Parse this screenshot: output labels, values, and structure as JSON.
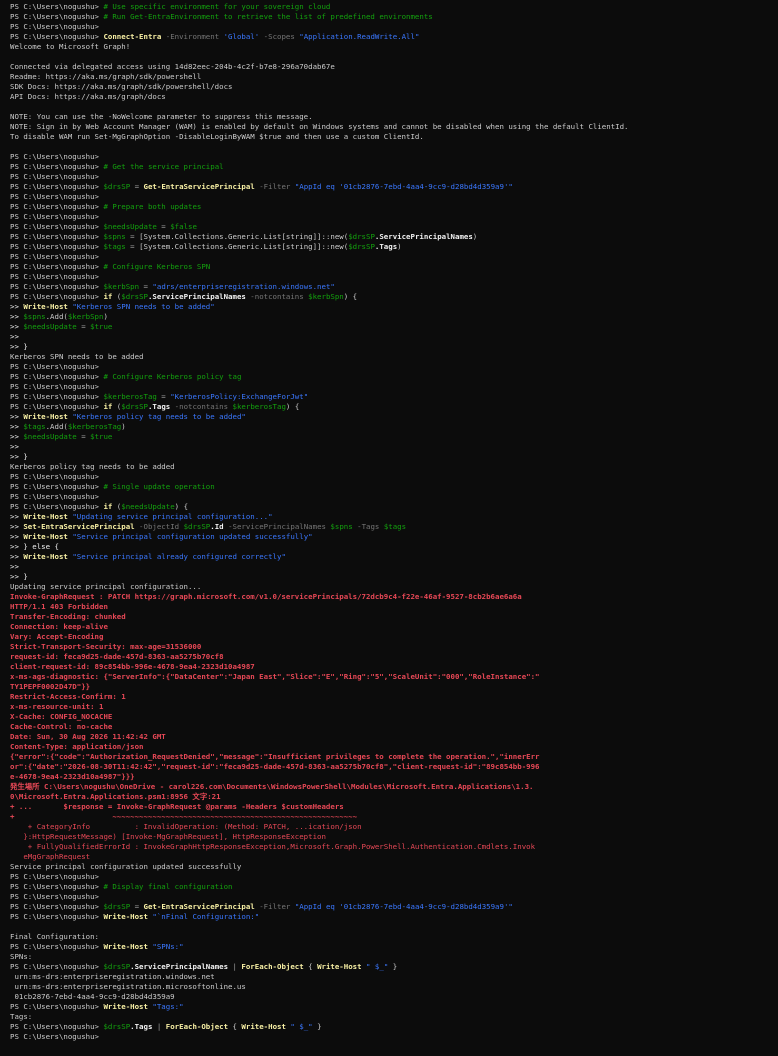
{
  "terminal": {
    "lines": [
      [
        [
          "PS C:\\Users\\nogushu> ",
          "plain"
        ],
        [
          "# Use specific environment for your sovereign cloud",
          "comment"
        ]
      ],
      [
        [
          "PS C:\\Users\\nogushu> ",
          "plain"
        ],
        [
          "# Run Get-EntraEnvironment to retrieve the list of predefined environments",
          "comment"
        ]
      ],
      [
        [
          "PS C:\\Users\\nogushu>",
          "plain"
        ]
      ],
      [
        [
          "PS C:\\Users\\nogushu> ",
          "plain"
        ],
        [
          "Connect-Entra",
          "cmd"
        ],
        [
          " -Environment ",
          "param"
        ],
        [
          "'Global'",
          "str"
        ],
        [
          " -Scopes ",
          "param"
        ],
        [
          "\"Application.ReadWrite.All\"",
          "str"
        ]
      ],
      [
        [
          "Welcome to Microsoft Graph!",
          "plain"
        ]
      ],
      [
        [
          "",
          "plain"
        ]
      ],
      [
        [
          "Connected via delegated access using 14d82eec-204b-4c2f-b7e8-296a70dab67e",
          "plain"
        ]
      ],
      [
        [
          "Readme: https://aka.ms/graph/sdk/powershell",
          "plain"
        ]
      ],
      [
        [
          "SDK Docs: https://aka.ms/graph/sdk/powershell/docs",
          "plain"
        ]
      ],
      [
        [
          "API Docs: https://aka.ms/graph/docs",
          "plain"
        ]
      ],
      [
        [
          "",
          "plain"
        ]
      ],
      [
        [
          "NOTE: You can use the -NoWelcome parameter to suppress this message.",
          "plain"
        ]
      ],
      [
        [
          "NOTE: Sign in by Web Account Manager (WAM) is enabled by default on Windows systems and cannot be disabled when using the default ClientId.",
          "plain"
        ]
      ],
      [
        [
          "To disable WAM run Set-MgGraphOption -DisableLoginByWAM $true and then use a custom ClientId.",
          "plain"
        ]
      ],
      [
        [
          "",
          "plain"
        ]
      ],
      [
        [
          "PS C:\\Users\\nogushu>",
          "plain"
        ]
      ],
      [
        [
          "PS C:\\Users\\nogushu> ",
          "plain"
        ],
        [
          "# Get the service principal",
          "comment"
        ]
      ],
      [
        [
          "PS C:\\Users\\nogushu>",
          "plain"
        ]
      ],
      [
        [
          "PS C:\\Users\\nogushu> ",
          "plain"
        ],
        [
          "$drsSP",
          "var"
        ],
        [
          " = ",
          "op"
        ],
        [
          "Get-EntraServicePrincipal",
          "cmd"
        ],
        [
          " -Filter ",
          "param"
        ],
        [
          "\"AppId eq '01cb2876-7ebd-4aa4-9cc9-d28bd4d359a9'\"",
          "str"
        ]
      ],
      [
        [
          "PS C:\\Users\\nogushu>",
          "plain"
        ]
      ],
      [
        [
          "PS C:\\Users\\nogushu> ",
          "plain"
        ],
        [
          "# Prepare both updates",
          "comment"
        ]
      ],
      [
        [
          "PS C:\\Users\\nogushu>",
          "plain"
        ]
      ],
      [
        [
          "PS C:\\Users\\nogushu> ",
          "plain"
        ],
        [
          "$needsUpdate",
          "var"
        ],
        [
          " = ",
          "op"
        ],
        [
          "$false",
          "var"
        ]
      ],
      [
        [
          "PS C:\\Users\\nogushu> ",
          "plain"
        ],
        [
          "$spns",
          "var"
        ],
        [
          " = ",
          "op"
        ],
        [
          "[System.Collections.Generic.List[string]]::new(",
          "type"
        ],
        [
          "$drsSP",
          "var"
        ],
        [
          ".ServicePrincipalNames",
          "prop"
        ],
        [
          ")",
          "type"
        ]
      ],
      [
        [
          "PS C:\\Users\\nogushu> ",
          "plain"
        ],
        [
          "$tags",
          "var"
        ],
        [
          " = ",
          "op"
        ],
        [
          "[System.Collections.Generic.List[string]]::new(",
          "type"
        ],
        [
          "$drsSP",
          "var"
        ],
        [
          ".Tags",
          "prop"
        ],
        [
          ")",
          "type"
        ]
      ],
      [
        [
          "PS C:\\Users\\nogushu>",
          "plain"
        ]
      ],
      [
        [
          "PS C:\\Users\\nogushu> ",
          "plain"
        ],
        [
          "# Configure Kerberos SPN",
          "comment"
        ]
      ],
      [
        [
          "PS C:\\Users\\nogushu>",
          "plain"
        ]
      ],
      [
        [
          "PS C:\\Users\\nogushu> ",
          "plain"
        ],
        [
          "$kerbSpn",
          "var"
        ],
        [
          " = ",
          "op"
        ],
        [
          "\"adrs/enterpriseregistration.windows.net\"",
          "str"
        ]
      ],
      [
        [
          "PS C:\\Users\\nogushu> ",
          "plain"
        ],
        [
          "if",
          "cmd"
        ],
        [
          " (",
          "type"
        ],
        [
          "$drsSP",
          "var"
        ],
        [
          ".ServicePrincipalNames",
          "prop"
        ],
        [
          " -notcontains ",
          "param"
        ],
        [
          "$kerbSpn",
          "var"
        ],
        [
          ") {",
          "type"
        ]
      ],
      [
        [
          ">> ",
          "cont"
        ],
        [
          "Write-Host",
          "cmd"
        ],
        [
          " ",
          "plain"
        ],
        [
          "\"Kerberos SPN needs to be added\"",
          "str"
        ]
      ],
      [
        [
          ">> ",
          "cont"
        ],
        [
          "$spns",
          "var"
        ],
        [
          ".Add(",
          "type"
        ],
        [
          "$kerbSpn",
          "var"
        ],
        [
          ")",
          "type"
        ]
      ],
      [
        [
          ">> ",
          "cont"
        ],
        [
          "$needsUpdate",
          "var"
        ],
        [
          " = ",
          "op"
        ],
        [
          "$true",
          "var"
        ]
      ],
      [
        [
          ">>",
          "cont"
        ]
      ],
      [
        [
          ">> }",
          "cont"
        ]
      ],
      [
        [
          "Kerberos SPN needs to be added",
          "plain"
        ]
      ],
      [
        [
          "PS C:\\Users\\nogushu>",
          "plain"
        ]
      ],
      [
        [
          "PS C:\\Users\\nogushu> ",
          "plain"
        ],
        [
          "# Configure Kerberos policy tag",
          "comment"
        ]
      ],
      [
        [
          "PS C:\\Users\\nogushu>",
          "plain"
        ]
      ],
      [
        [
          "PS C:\\Users\\nogushu> ",
          "plain"
        ],
        [
          "$kerberosTag",
          "var"
        ],
        [
          " = ",
          "op"
        ],
        [
          "\"KerberosPolicy:ExchangeForJwt\"",
          "str"
        ]
      ],
      [
        [
          "PS C:\\Users\\nogushu> ",
          "plain"
        ],
        [
          "if",
          "cmd"
        ],
        [
          " (",
          "type"
        ],
        [
          "$drsSP",
          "var"
        ],
        [
          ".Tags",
          "prop"
        ],
        [
          " -notcontains ",
          "param"
        ],
        [
          "$kerberosTag",
          "var"
        ],
        [
          ") {",
          "type"
        ]
      ],
      [
        [
          ">> ",
          "cont"
        ],
        [
          "Write-Host",
          "cmd"
        ],
        [
          " ",
          "plain"
        ],
        [
          "\"Kerberos policy tag needs to be added\"",
          "str"
        ]
      ],
      [
        [
          ">> ",
          "cont"
        ],
        [
          "$tags",
          "var"
        ],
        [
          ".Add(",
          "type"
        ],
        [
          "$kerberosTag",
          "var"
        ],
        [
          ")",
          "type"
        ]
      ],
      [
        [
          ">> ",
          "cont"
        ],
        [
          "$needsUpdate",
          "var"
        ],
        [
          " = ",
          "op"
        ],
        [
          "$true",
          "var"
        ]
      ],
      [
        [
          ">>",
          "cont"
        ]
      ],
      [
        [
          ">> }",
          "cont"
        ]
      ],
      [
        [
          "Kerberos policy tag needs to be added",
          "plain"
        ]
      ],
      [
        [
          "PS C:\\Users\\nogushu>",
          "plain"
        ]
      ],
      [
        [
          "PS C:\\Users\\nogushu> ",
          "plain"
        ],
        [
          "# Single update operation",
          "comment"
        ]
      ],
      [
        [
          "PS C:\\Users\\nogushu>",
          "plain"
        ]
      ],
      [
        [
          "PS C:\\Users\\nogushu> ",
          "plain"
        ],
        [
          "if",
          "cmd"
        ],
        [
          " (",
          "type"
        ],
        [
          "$needsUpdate",
          "var"
        ],
        [
          ") {",
          "type"
        ]
      ],
      [
        [
          ">> ",
          "cont"
        ],
        [
          "Write-Host",
          "cmd"
        ],
        [
          " ",
          "plain"
        ],
        [
          "\"Updating service principal configuration...\"",
          "str"
        ]
      ],
      [
        [
          ">> ",
          "cont"
        ],
        [
          "Set-EntraServicePrincipal",
          "cmd"
        ],
        [
          " -ObjectId ",
          "param"
        ],
        [
          "$drsSP",
          "var"
        ],
        [
          ".Id",
          "prop"
        ],
        [
          " -ServicePrincipalNames ",
          "param"
        ],
        [
          "$spns",
          "var"
        ],
        [
          " -Tags ",
          "param"
        ],
        [
          "$tags",
          "var"
        ]
      ],
      [
        [
          ">> ",
          "cont"
        ],
        [
          "Write-Host",
          "cmd"
        ],
        [
          " ",
          "plain"
        ],
        [
          "\"Service principal configuration updated successfully\"",
          "str"
        ]
      ],
      [
        [
          ">> } else {",
          "cont"
        ]
      ],
      [
        [
          ">> ",
          "cont"
        ],
        [
          "Write-Host",
          "cmd"
        ],
        [
          " ",
          "plain"
        ],
        [
          "\"Service principal already configured correctly\"",
          "str"
        ]
      ],
      [
        [
          ">>",
          "cont"
        ]
      ],
      [
        [
          ">> }",
          "cont"
        ]
      ],
      [
        [
          "Updating service principal configuration...",
          "plain"
        ]
      ],
      [
        [
          "Invoke-GraphRequest : PATCH https://graph.microsoft.com/v1.0/servicePrincipals/72dcb9c4-f22e-46af-9527-8cb2b6ae6a6a",
          "err"
        ]
      ],
      [
        [
          "HTTP/1.1 403 Forbidden",
          "err"
        ]
      ],
      [
        [
          "Transfer-Encoding: chunked",
          "err"
        ]
      ],
      [
        [
          "Connection: keep-alive",
          "err"
        ]
      ],
      [
        [
          "Vary: Accept-Encoding",
          "err"
        ]
      ],
      [
        [
          "Strict-Transport-Security: max-age=31536000",
          "err"
        ]
      ],
      [
        [
          "request-id: feca9d25-dade-457d-8363-aa5275b70cf8",
          "err"
        ]
      ],
      [
        [
          "client-request-id: 89c854bb-996e-4678-9ea4-2323d10a4987",
          "err"
        ]
      ],
      [
        [
          "x-ms-ags-diagnostic: {\"ServerInfo\":{\"DataCenter\":\"Japan East\",\"Slice\":\"E\",\"Ring\":\"5\",\"ScaleUnit\":\"000\",\"RoleInstance\":\"",
          "err"
        ]
      ],
      [
        [
          "TY1PEPF0002D47D\"}}",
          "err"
        ]
      ],
      [
        [
          "Restrict-Access-Confirm: 1",
          "err"
        ]
      ],
      [
        [
          "x-ms-resource-unit: 1",
          "err"
        ]
      ],
      [
        [
          "X-Cache: CONFIG_NOCACHE",
          "err"
        ]
      ],
      [
        [
          "Cache-Control: no-cache",
          "err"
        ]
      ],
      [
        [
          "Date: Sun, 30 Aug 2026 11:42:42 GMT",
          "err"
        ]
      ],
      [
        [
          "Content-Type: application/json",
          "err"
        ]
      ],
      [
        [
          "{\"error\":{\"code\":\"Authorization_RequestDenied\",\"message\":\"Insufficient privileges to complete the operation.\",\"innerErr",
          "err"
        ]
      ],
      [
        [
          "or\":{\"date\":\"2026-08-30T11:42:42\",\"request-id\":\"feca9d25-dade-457d-8363-aa5275b70cf8\",\"client-request-id\":\"89c854bb-996",
          "err"
        ]
      ],
      [
        [
          "e-4678-9ea4-2323d10a4987\"}}}",
          "err"
        ]
      ],
      [
        [
          "発生場所 C:\\Users\\nogushu\\OneDrive - carol226.com\\Documents\\WindowsPowerShell\\Modules\\Microsoft.Entra.Applications\\1.3.",
          "err"
        ]
      ],
      [
        [
          "0\\Microsoft.Entra.Applications.psm1:8956 文字:21",
          "err"
        ]
      ],
      [
        [
          "+ ...       $response = Invoke-GraphRequest @params -Headers $customHeaders",
          "err"
        ]
      ],
      [
        [
          "+                      ~~~~~~~~~~~~~~~~~~~~~~~~~~~~~~~~~~~~~~~~~~~~~~~~~~~~~~~",
          "err"
        ]
      ],
      [
        [
          "    + CategoryInfo          : InvalidOperation: (Method: PATCH, ...ication/json",
          "errd"
        ]
      ],
      [
        [
          "   }:HttpRequestMessage) [Invoke-MgGraphRequest], HttpResponseException",
          "errd"
        ]
      ],
      [
        [
          "    + FullyQualifiedErrorId : InvokeGraphHttpResponseException,Microsoft.Graph.PowerShell.Authentication.Cmdlets.Invok",
          "errd"
        ]
      ],
      [
        [
          "   eMgGraphRequest",
          "errd"
        ]
      ],
      [
        [
          "Service principal configuration updated successfully",
          "plain"
        ]
      ],
      [
        [
          "PS C:\\Users\\nogushu>",
          "plain"
        ]
      ],
      [
        [
          "PS C:\\Users\\nogushu> ",
          "plain"
        ],
        [
          "# Display final configuration",
          "comment"
        ]
      ],
      [
        [
          "PS C:\\Users\\nogushu>",
          "plain"
        ]
      ],
      [
        [
          "PS C:\\Users\\nogushu> ",
          "plain"
        ],
        [
          "$drsSP",
          "var"
        ],
        [
          " = ",
          "op"
        ],
        [
          "Get-EntraServicePrincipal",
          "cmd"
        ],
        [
          " -Filter ",
          "param"
        ],
        [
          "\"AppId eq '01cb2876-7ebd-4aa4-9cc9-d28bd4d359a9'\"",
          "str"
        ]
      ],
      [
        [
          "PS C:\\Users\\nogushu> ",
          "plain"
        ],
        [
          "Write-Host",
          "cmd"
        ],
        [
          " ",
          "plain"
        ],
        [
          "\"`nFinal Configuration:\"",
          "str"
        ]
      ],
      [
        [
          "",
          "plain"
        ]
      ],
      [
        [
          "Final Configuration:",
          "plain"
        ]
      ],
      [
        [
          "PS C:\\Users\\nogushu> ",
          "plain"
        ],
        [
          "Write-Host",
          "cmd"
        ],
        [
          " ",
          "plain"
        ],
        [
          "\"SPNs:\"",
          "str"
        ]
      ],
      [
        [
          "SPNs:",
          "plain"
        ]
      ],
      [
        [
          "PS C:\\Users\\nogushu> ",
          "plain"
        ],
        [
          "$drsSP",
          "var"
        ],
        [
          ".ServicePrincipalNames",
          "prop"
        ],
        [
          " | ",
          "op"
        ],
        [
          "ForEach-Object",
          "cmd"
        ],
        [
          " { ",
          "type"
        ],
        [
          "Write-Host",
          "cmd"
        ],
        [
          " ",
          "plain"
        ],
        [
          "\" $_\"",
          "str"
        ],
        [
          " }",
          "type"
        ]
      ],
      [
        [
          " urn:ms-drs:enterpriseregistration.windows.net",
          "plain"
        ]
      ],
      [
        [
          " urn:ms-drs:enterpriseregistration.microsoftonline.us",
          "plain"
        ]
      ],
      [
        [
          " 01cb2876-7ebd-4aa4-9cc9-d28bd4d359a9",
          "plain"
        ]
      ],
      [
        [
          "PS C:\\Users\\nogushu> ",
          "plain"
        ],
        [
          "Write-Host",
          "cmd"
        ],
        [
          " ",
          "plain"
        ],
        [
          "\"Tags:\"",
          "str"
        ]
      ],
      [
        [
          "Tags:",
          "plain"
        ]
      ],
      [
        [
          "PS C:\\Users\\nogushu> ",
          "plain"
        ],
        [
          "$drsSP",
          "var"
        ],
        [
          ".Tags",
          "prop"
        ],
        [
          " | ",
          "op"
        ],
        [
          "ForEach-Object",
          "cmd"
        ],
        [
          " { ",
          "type"
        ],
        [
          "Write-Host",
          "cmd"
        ],
        [
          " ",
          "plain"
        ],
        [
          "\" $_\"",
          "str"
        ],
        [
          " }",
          "type"
        ]
      ],
      [
        [
          "PS C:\\Users\\nogushu>",
          "plain"
        ]
      ]
    ]
  },
  "colors": {
    "background": "#0c0c0c",
    "text": "#cccccc",
    "comment": "#13a10e",
    "command": "#f9f1a5",
    "string": "#3b78ff",
    "error": "#e74856"
  }
}
